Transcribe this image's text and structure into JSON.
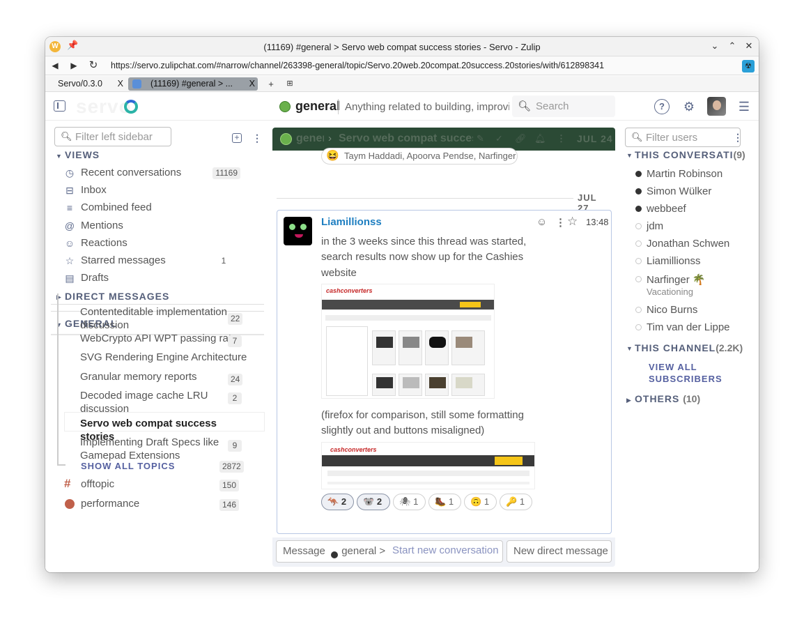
{
  "window": {
    "title": "(11169) #general > Servo web compat success stories - Servo - Zulip",
    "logo_letter": "W",
    "url": "https://servo.zulipchat.com/#narrow/channel/263398-general/topic/Servo.20web.20compat.20success.20stories/with/612898341"
  },
  "tabs": [
    {
      "label": "Servo/0.3.0",
      "close": "X"
    },
    {
      "label": "(11169) #general > ...",
      "close": "X"
    }
  ],
  "header": {
    "logo": "servo",
    "stream": "general",
    "description": "Anything related to building, improving, or using Servo",
    "search_placeholder": "Search"
  },
  "left": {
    "filter_placeholder": "Filter left sidebar",
    "views_title": "VIEWS",
    "views": [
      {
        "label": "Recent conversations",
        "count": "11169",
        "icon": "clock-icon"
      },
      {
        "label": "Inbox",
        "count": "",
        "icon": "inbox-icon"
      },
      {
        "label": "Combined feed",
        "count": "",
        "icon": "feed-icon"
      },
      {
        "label": "Mentions",
        "count": "",
        "icon": "at-icon"
      },
      {
        "label": "Reactions",
        "count": "",
        "icon": "smile-icon"
      },
      {
        "label": "Starred messages",
        "count": "1",
        "icon": "star-icon"
      },
      {
        "label": "Drafts",
        "count": "",
        "icon": "draft-icon"
      }
    ],
    "dm_title": "DIRECT MESSAGES",
    "general_title": "GENERAL",
    "topics": [
      {
        "label": "Contenteditable implementation discussion",
        "count": "22"
      },
      {
        "label": "WebCrypto API WPT passing rate",
        "count": "7"
      },
      {
        "label": "SVG Rendering Engine Architecture",
        "count": ""
      },
      {
        "label": "Granular memory reports",
        "count": "24"
      },
      {
        "label": "Decoded image cache LRU discussion",
        "count": "2"
      },
      {
        "label": "Servo web compat success stories",
        "count": ""
      },
      {
        "label": "Implementing Draft Specs like Gamepad Extensions",
        "count": "9"
      }
    ],
    "show_all_topics": "SHOW ALL TOPICS",
    "show_all_count": "2872",
    "streams": [
      {
        "label": "offtopic",
        "count": "150"
      },
      {
        "label": "performance",
        "count": "146"
      }
    ]
  },
  "recipient_bar": {
    "stream": "general",
    "topic": "Servo web compat success stories",
    "date": "JUL 24"
  },
  "prev_reaction": {
    "emoji": "😆",
    "names": "Taym Haddadi, Apoorva Pendse, Narfinger"
  },
  "date_separator": "JUL 27",
  "message": {
    "sender": "Liamillionss",
    "time": "13:48",
    "text1_l1": "in the 3 weeks since this thread was started,",
    "text1_l2": "search results now show up for the Cashies",
    "text1_l3": "website",
    "text2_l1": "(firefox for comparison, still some formatting",
    "text2_l2": "slightly out and buttons misaligned)",
    "shot_logo": "cashconverters",
    "reactions": [
      {
        "emoji": "🦘",
        "count": "2"
      },
      {
        "emoji": "🐨",
        "count": "2"
      },
      {
        "emoji": "🕷",
        "count": "1"
      },
      {
        "emoji": "🥾",
        "count": "1"
      },
      {
        "emoji": "🙃",
        "count": "1"
      },
      {
        "emoji": "🔑",
        "count": "1"
      }
    ]
  },
  "compose": {
    "message_prefix": "Message",
    "message_target": "general > Servo web compat success stories",
    "new_conversation": "Start new conversation",
    "new_dm": "New direct message"
  },
  "right": {
    "filter_placeholder": "Filter users",
    "this_conversation": "THIS CONVERSATI",
    "this_conversation_count": "(9)",
    "users": [
      {
        "name": "Martin Robinson",
        "online": true,
        "status": ""
      },
      {
        "name": "Simon Wülker",
        "online": true,
        "status": ""
      },
      {
        "name": "webbeef",
        "online": true,
        "status": ""
      },
      {
        "name": "jdm",
        "online": false,
        "status": ""
      },
      {
        "name": "Jonathan Schwender",
        "online": false,
        "status": ""
      },
      {
        "name": "Liamillionss",
        "online": false,
        "status": ""
      },
      {
        "name": "Narfinger 🌴",
        "online": false,
        "status": "Vacationing"
      },
      {
        "name": "Nico Burns",
        "online": false,
        "status": ""
      },
      {
        "name": "Tim van der Lippe",
        "online": false,
        "status": ""
      }
    ],
    "this_channel": "THIS CHANNEL",
    "this_channel_count": "(2.2K)",
    "view_all_l1": "VIEW ALL",
    "view_all_l2": "SUBSCRIBERS",
    "others": "OTHERS",
    "others_count": "(10)"
  },
  "colors": {
    "recipient_bar": "#2b4a35",
    "link": "#1f7fc1",
    "online": "#333333"
  }
}
